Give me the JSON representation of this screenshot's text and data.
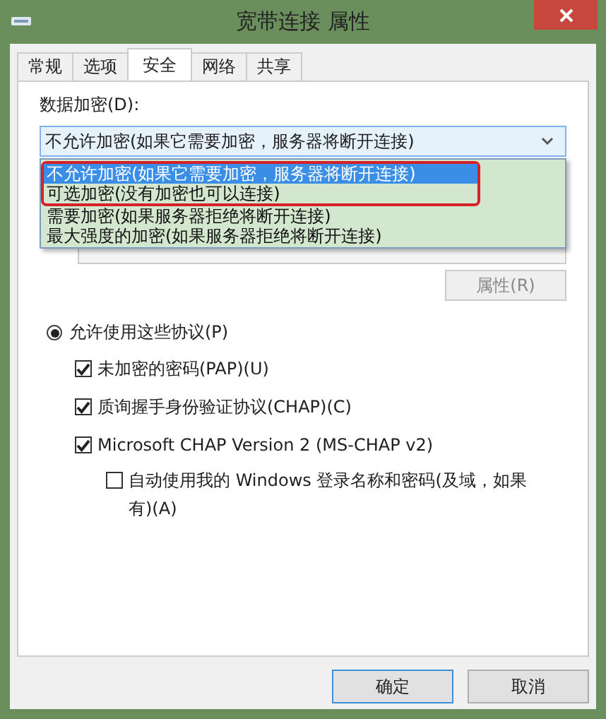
{
  "window": {
    "title": "宽带连接 属性"
  },
  "tabs": [
    {
      "label": "常规",
      "selected": false
    },
    {
      "label": "选项",
      "selected": false
    },
    {
      "label": "安全",
      "selected": true
    },
    {
      "label": "网络",
      "selected": false
    },
    {
      "label": "共享",
      "selected": false
    }
  ],
  "encryption": {
    "label": "数据加密(D):",
    "value": "不允许加密(如果它需要加密，服务器将断开连接)",
    "expanded": true,
    "options": [
      {
        "label": "不允许加密(如果它需要加密，服务器将断开连接)",
        "selected": true,
        "annotated": true
      },
      {
        "label": "可选加密(没有加密也可以连接)",
        "selected": false,
        "annotated": true
      },
      {
        "label": "需要加密(如果服务器拒绝将断开连接)",
        "selected": false,
        "annotated": false
      },
      {
        "label": "最大强度的加密(如果服务器拒绝将断开连接)",
        "selected": false,
        "annotated": false
      }
    ]
  },
  "properties_button": {
    "label": "属性(R)",
    "disabled": true
  },
  "protocols": {
    "label": "允许使用这些协议(P)",
    "selected": true,
    "items": [
      {
        "label": "未加密的密码(PAP)(U)",
        "checked": true
      },
      {
        "label": "质询握手身份验证协议(CHAP)(C)",
        "checked": true
      },
      {
        "label": "Microsoft CHAP Version 2 (MS-CHAP v2)",
        "checked": true,
        "children": [
          {
            "label": "自动使用我的 Windows 登录名称和密码(及域，如果有)(A)",
            "checked": false
          }
        ]
      }
    ]
  },
  "buttons": [
    {
      "label": "确定",
      "default": true
    },
    {
      "label": "取消",
      "default": false
    }
  ]
}
